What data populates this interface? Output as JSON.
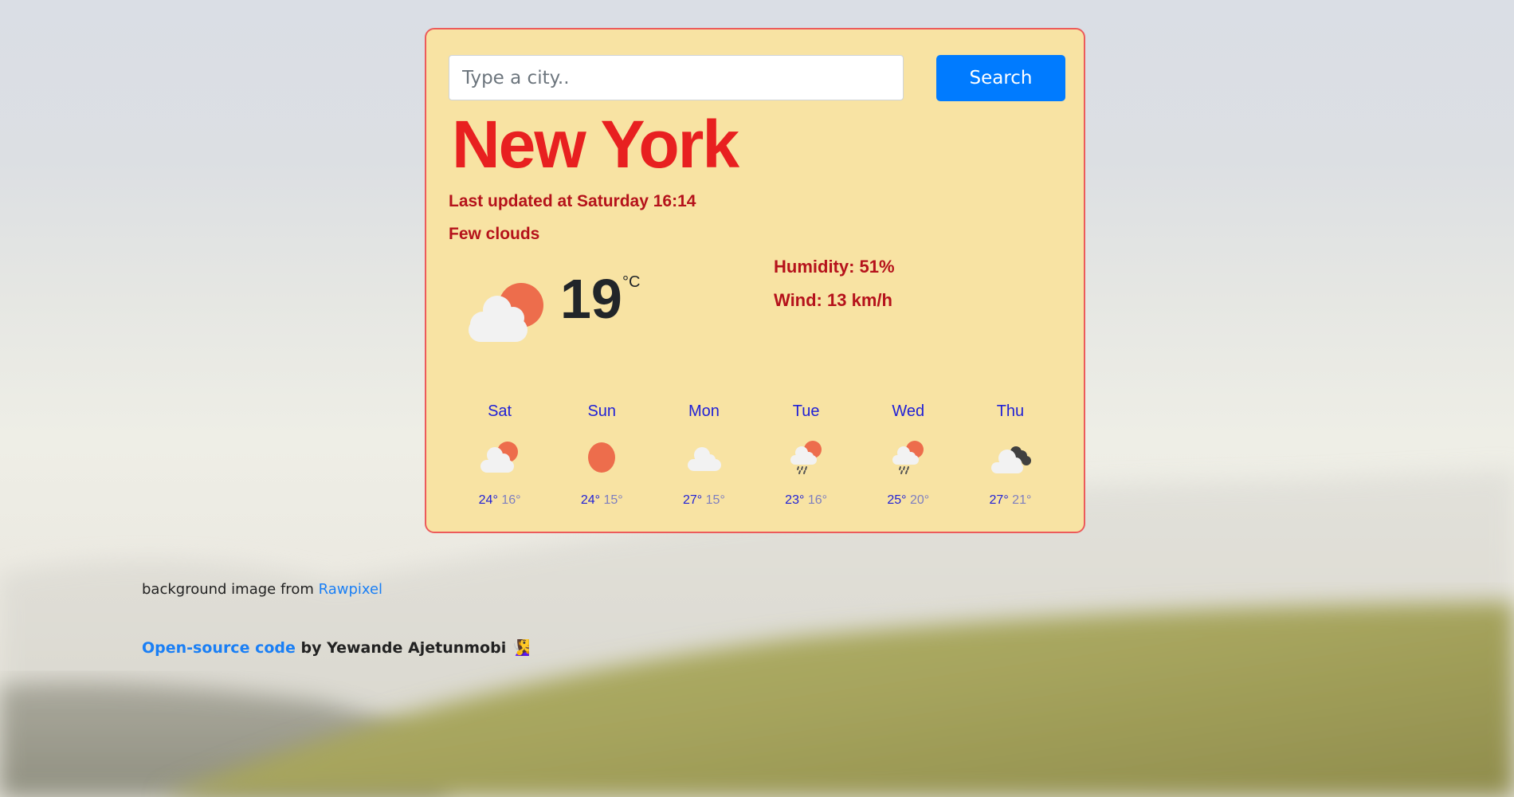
{
  "search": {
    "placeholder": "Type a city..",
    "value": "",
    "button_label": "Search"
  },
  "current": {
    "city": "New York",
    "last_updated": "Last updated at Saturday 16:14",
    "description": "Few clouds",
    "icon": "few-clouds-day-icon",
    "temperature": "19",
    "unit": "°C",
    "humidity": "Humidity: 51%",
    "wind": "Wind: 13 km/h"
  },
  "forecast": [
    {
      "day": "Sat",
      "icon": "few-clouds-day-icon",
      "max": "24°",
      "min": "16°"
    },
    {
      "day": "Sun",
      "icon": "clear-sky-icon",
      "max": "24°",
      "min": "15°"
    },
    {
      "day": "Mon",
      "icon": "cloud-icon",
      "max": "27°",
      "min": "15°"
    },
    {
      "day": "Tue",
      "icon": "rain-day-icon",
      "max": "23°",
      "min": "16°"
    },
    {
      "day": "Wed",
      "icon": "rain-day-icon",
      "max": "25°",
      "min": "20°"
    },
    {
      "day": "Thu",
      "icon": "broken-clouds-icon",
      "max": "27°",
      "min": "21°"
    }
  ],
  "footer": {
    "credit_text": "background image from ",
    "credit_link": "Rawpixel",
    "source_link": "Open-source code",
    "source_text": " by Yewande Ajetunmobi ",
    "emoji": "🧏‍♀️"
  },
  "colors": {
    "card_bg": "#f8e3a3",
    "card_border": "#ec5b5b",
    "city": "#e82020",
    "details": "#b5121b",
    "button": "#007bff",
    "forecast_day": "#2121d6",
    "sun": "#ed6d4c",
    "cloud": "#f2f2f2",
    "dark_cloud": "#404040"
  }
}
